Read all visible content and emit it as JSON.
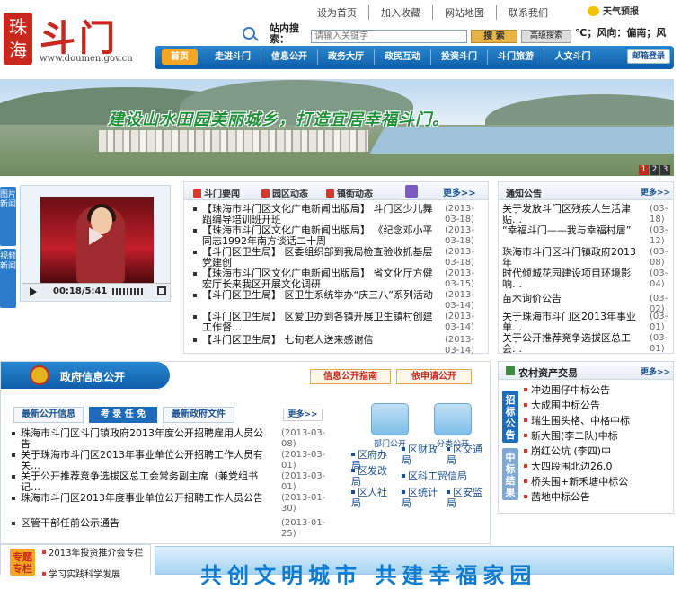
{
  "header": {
    "logo_seal": "珠海",
    "logo_name": "斗门",
    "logo_url": "www.doumen.gov.cn",
    "top_links": [
      "设为首页",
      "加入收藏",
      "网站地图",
      "联系我们"
    ],
    "weather_label": "天气预报",
    "wind_text": "℃；风向：偏南；风",
    "search_label": "站内搜索：",
    "search_placeholder": "请输入关键字",
    "search_button": "搜 索",
    "advanced_button": "高级搜索"
  },
  "nav": {
    "items": [
      "首页",
      "走进斗门",
      "信息公开",
      "政务大厅",
      "政民互动",
      "投资斗门",
      "斗门旅游",
      "人文斗门"
    ],
    "mail_button": "邮箱登录"
  },
  "banner": {
    "slogan": "建设山水田园美丽城乡，打造宜居幸福斗门。",
    "pages": [
      "1",
      "2",
      "3"
    ]
  },
  "side_tabs": [
    "图片新闻",
    "视频新闻"
  ],
  "video": {
    "time": "00:18/5:41"
  },
  "news": {
    "tabs": [
      "斗门要闻",
      "园区动态",
      "镇街动态"
    ],
    "more": "更多>>",
    "items": [
      {
        "title": "【珠海市斗门区文化广电新闻出版局】 斗门区少儿舞蹈编导培训班开班",
        "date": "(2013-03-18)"
      },
      {
        "title": "【珠海市斗门区文化广电新闻出版局】 《纪念邓小平同志1992年南方谈话二十周",
        "date": "(2013-03-18)"
      },
      {
        "title": "【斗门区卫生局】 区委组织部到我局检查验收抓基层党建创",
        "date": "(2013-03-18)"
      },
      {
        "title": "【珠海市斗门区文化广电新闻出版局】 省文化厅方健宏厅长来我区开展文化调研",
        "date": "(2013-03-15)"
      },
      {
        "title": "【斗门区卫生局】 区卫生系统举办“庆三八”系列活动",
        "date": "(2013-03-14)"
      },
      {
        "title": "【斗门区卫生局】 区爱卫办到各镇开展卫生镇村创建工作督…",
        "date": "(2013-03-14)"
      },
      {
        "title": "【斗门区卫生局】 七旬老人送来感谢信",
        "date": "(2013-03-14)"
      }
    ]
  },
  "notice": {
    "title": "通知公告",
    "more": "更多>>",
    "items": [
      {
        "title": "关于发放斗门区残疾人生活津贴…",
        "date": "(03-18)"
      },
      {
        "title": "“幸福斗门——我与幸福村居”",
        "date": "(03-12)"
      },
      {
        "title": "珠海市斗门区斗门镇政府2013年",
        "date": "(03-08)"
      },
      {
        "title": "时代倾城花园建设项目环境影响…",
        "date": "(03-04)"
      },
      {
        "title": "苗木询价公告",
        "date": "(03-02)"
      },
      {
        "title": "关于珠海市斗门区2013年事业单…",
        "date": "(03-01)"
      },
      {
        "title": "关于公开推荐竞争选拔区总工会…",
        "date": "(03-01)"
      }
    ]
  },
  "gov": {
    "title": "政府信息公开",
    "guide_button": "信息公开指南",
    "apply_button": "依申请公开",
    "tabs": [
      "最新公开信息",
      "考 录 任 免",
      "最新政府文件"
    ],
    "more": "更多>>",
    "items": [
      {
        "title": "珠海市斗门区斗门镇政府2013年度公开招聘雇用人员公告",
        "date": "(2013-03-08)"
      },
      {
        "title": "关于珠海市斗门区2013年事业单位公开招聘工作人员有关…",
        "date": "(2013-03-01)"
      },
      {
        "title": "关于公开推荐竞争选拔区总工会常务副主席（兼党组书记…",
        "date": "(2013-03-01)"
      },
      {
        "title": "珠海市斗门区2013年度事业单位公开招聘工作人员公告",
        "date": "(2013-01-30)"
      },
      {
        "title": "区管干部任前公示通告",
        "date": "(2013-01-25)"
      }
    ],
    "big_buttons": [
      "部门公开",
      "分类公开"
    ],
    "departments": [
      "区府办局",
      "区财政局",
      "区交通局",
      "区发改局",
      "区科工贸信局",
      "区人社局",
      "区统计局",
      "区安监局"
    ]
  },
  "rural": {
    "title": "农村资产交易",
    "more": "更多>>",
    "tabs": [
      "招标公告",
      "中标结果"
    ],
    "items": [
      "冲边围仔中标公告",
      "大成围中标公告",
      "瑞生围头格、中格中标",
      "新大围(李二队)中标",
      "崩红公坑 (李四)中",
      "大四段围北边26.0",
      "桥头围+新禾塘中标公",
      "茜地中标公告"
    ]
  },
  "topic": {
    "tab": "专题专栏",
    "items": [
      "2013年投资推介会专栏",
      "学习实践科学发展"
    ]
  },
  "bottom_banner": {
    "slogan": "共创文明城市 共建幸福家园"
  }
}
